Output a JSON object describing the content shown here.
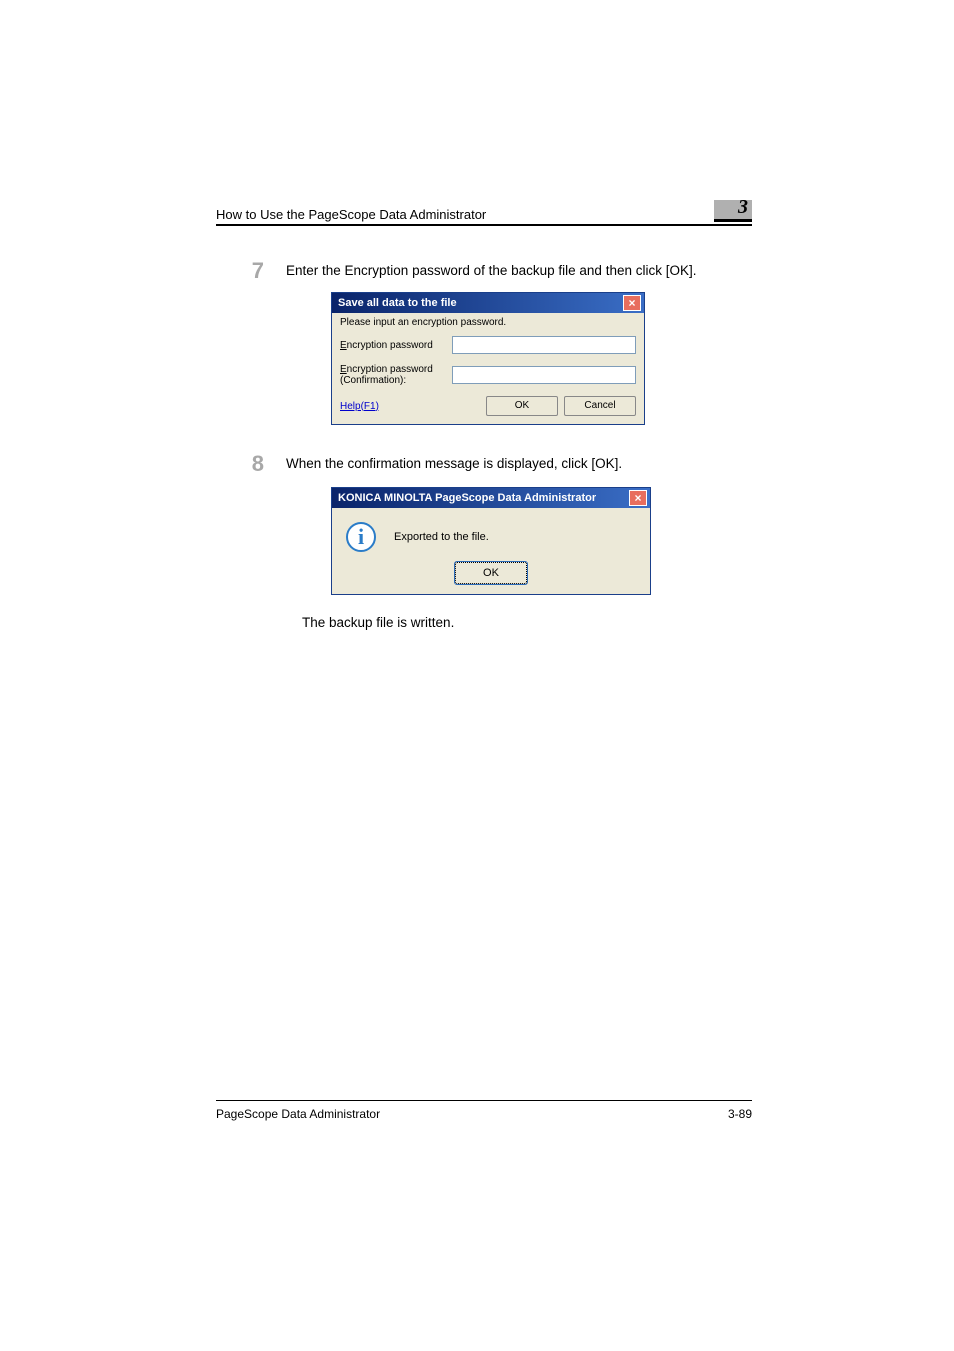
{
  "header": {
    "title": "How to Use the PageScope Data Administrator",
    "chapter": "3"
  },
  "steps": {
    "s7": {
      "num": "7",
      "text": "Enter the Encryption password of the backup file and then click [OK]."
    },
    "s8": {
      "num": "8",
      "text": "When the confirmation message is displayed, click [OK]."
    }
  },
  "dialog1": {
    "title": "Save all data to the file",
    "instruction": "Please input an encryption password.",
    "label_pw_pre": "E",
    "label_pw_post": "ncryption password",
    "label_conf_pre": "E",
    "label_conf_post1": "ncryption password",
    "label_conf_post2": "(Confirmation):",
    "help": "Help(F1)",
    "ok": "OK",
    "cancel": "Cancel"
  },
  "dialog2": {
    "title": "KONICA MINOLTA PageScope Data Administrator",
    "message": "Exported to the file.",
    "ok": "OK"
  },
  "result": "The backup file is written.",
  "footer": {
    "left": "PageScope Data Administrator",
    "right": "3-89"
  }
}
